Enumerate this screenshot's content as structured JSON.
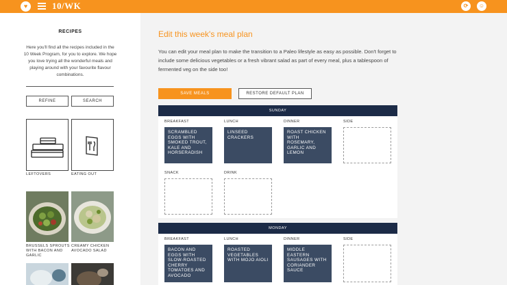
{
  "brand": {
    "name": "10/WK",
    "badge": "♥"
  },
  "colors": {
    "accent": "#f7931e",
    "header_navy": "#1c2b47",
    "meal_tile": "#3b4b63"
  },
  "topbar": {
    "icons": [
      "refresh-icon",
      "user-icon"
    ]
  },
  "sidebar": {
    "title": "RECIPES",
    "intro": "Here you'll find all the recipes included in the 10 Week Program, for you to explore. We hope you love trying all the wonderful meals and playing around with your favourite flavour combinations.",
    "refine_label": "REFINE",
    "search_label": "SEARCH",
    "tiles": [
      {
        "label": "LEFTOVERS",
        "icon": "leftovers-containers-icon"
      },
      {
        "label": "EATING OUT",
        "icon": "menu-cutlery-icon"
      }
    ],
    "recipes": [
      {
        "label": "BRUSSELS SPROUTS WITH BACON AND GARLIC"
      },
      {
        "label": "CREAMY CHICKEN AVOCADO SALAD"
      }
    ]
  },
  "main": {
    "title": "Edit this week's meal plan",
    "description": "You can edit your meal plan to make the transition to a Paleo lifestyle as easy as possible. Don't forget to include some delicious vegetables or a fresh vibrant salad as part of every meal, plus a tablespoon of fermented veg on the side too!",
    "save_label": "SAVE MEALS",
    "restore_label": "RESTORE DEFAULT PLAN"
  },
  "slot_labels": {
    "breakfast": "BREAKFAST",
    "lunch": "LUNCH",
    "dinner": "DINNER",
    "side": "SIDE",
    "snack": "SNACK",
    "drink": "DRINK"
  },
  "days": [
    {
      "name": "SUNDAY",
      "breakfast": "SCRAMBLED EGGS WITH SMOKED TROUT, KALE AND HORSERADISH",
      "lunch": "LINSEED CRACKERS",
      "dinner": "ROAST CHICKEN WITH ROSEMARY, GARLIC AND LEMON"
    },
    {
      "name": "MONDAY",
      "breakfast": "BACON AND EGGS WITH SLOW-ROASTED CHERRY TOMATOES AND AVOCADO",
      "lunch": "ROASTED VEGETABLES WITH MOJO AIOLI",
      "dinner": "MIDDLE EASTERN SAUSAGES WITH CORIANDER SAUCE"
    }
  ]
}
